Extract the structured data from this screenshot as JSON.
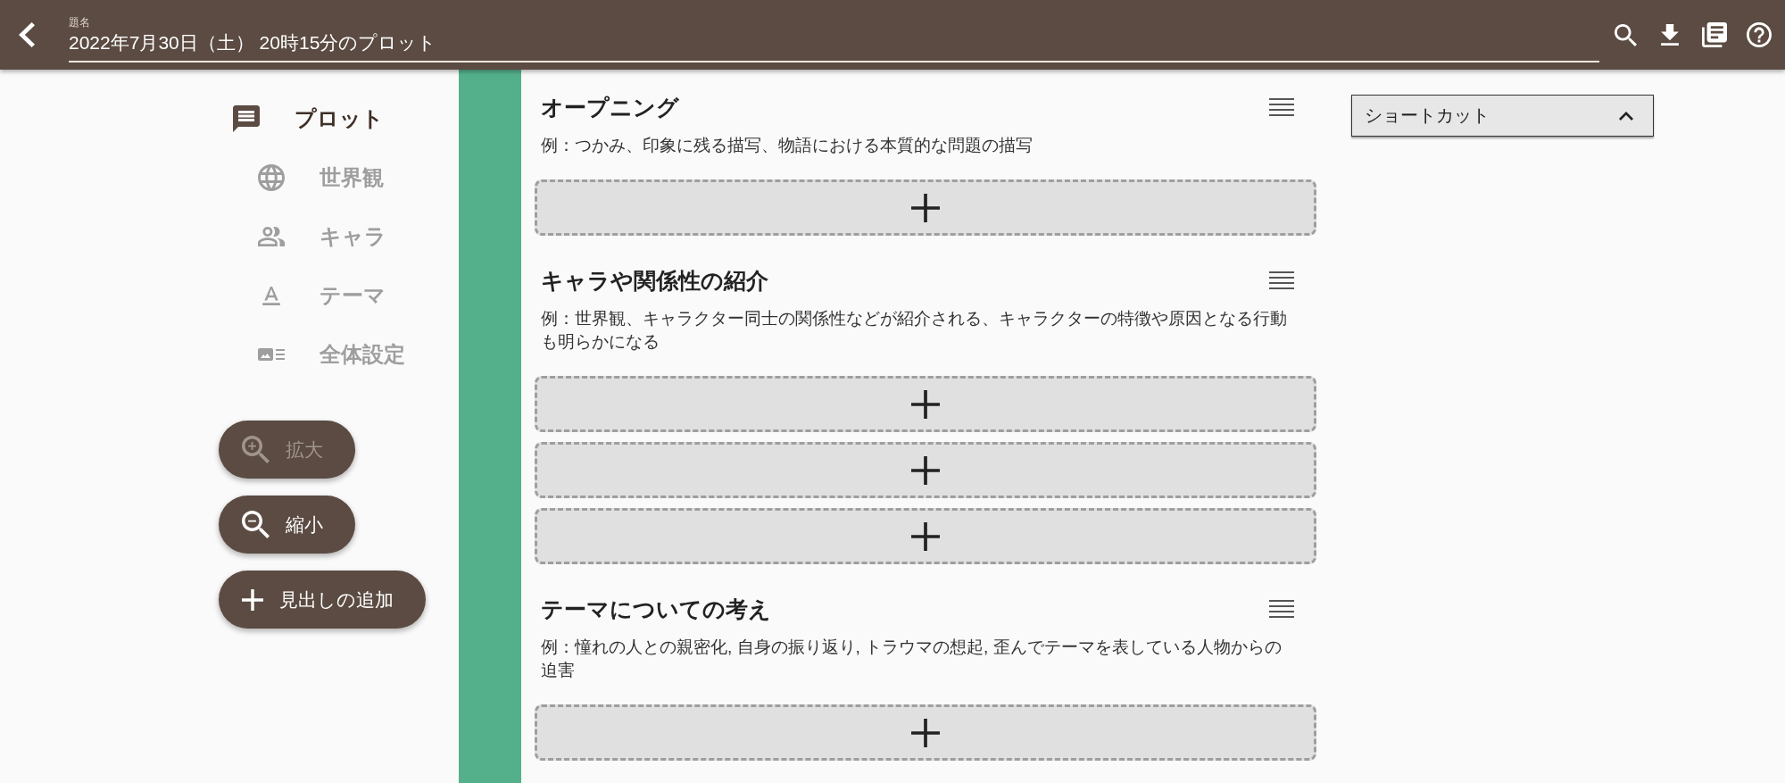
{
  "header": {
    "field_label": "題名",
    "title": "2022年7月30日（土） 20時15分のプロット"
  },
  "sidebar": {
    "nav_items": [
      {
        "label": "プロット",
        "selected": true
      },
      {
        "label": "世界観",
        "selected": false
      },
      {
        "label": "キャラ",
        "selected": false
      },
      {
        "label": "テーマ",
        "selected": false
      },
      {
        "label": "全体設定",
        "selected": false
      }
    ],
    "buttons": [
      {
        "label": "拡大",
        "disabled": true
      },
      {
        "label": "縮小",
        "disabled": false
      },
      {
        "label": "見出しの追加",
        "disabled": false
      }
    ]
  },
  "sections": [
    {
      "title": "オープニング",
      "description": "例：つかみ、印象に残る描写、物語における本質的な問題の描写",
      "cards": [
        {
          "kind": "add"
        }
      ]
    },
    {
      "title": "キャラや関係性の紹介",
      "description": "例：世界観、キャラクター同士の関係性などが紹介される、キャラクターの特徴や原因となる行動も明らかになる",
      "cards": [
        {
          "kind": "add"
        },
        {
          "kind": "add"
        },
        {
          "kind": "add"
        }
      ]
    },
    {
      "title": "テーマについての考え",
      "description": "例：憧れの人との親密化, 自身の振り返り, トラウマの想起, 歪んでテーマを表している人物からの迫害",
      "cards": [
        {
          "kind": "add"
        }
      ]
    }
  ],
  "shortcut": {
    "label": "ショートカット",
    "expanded": true
  }
}
